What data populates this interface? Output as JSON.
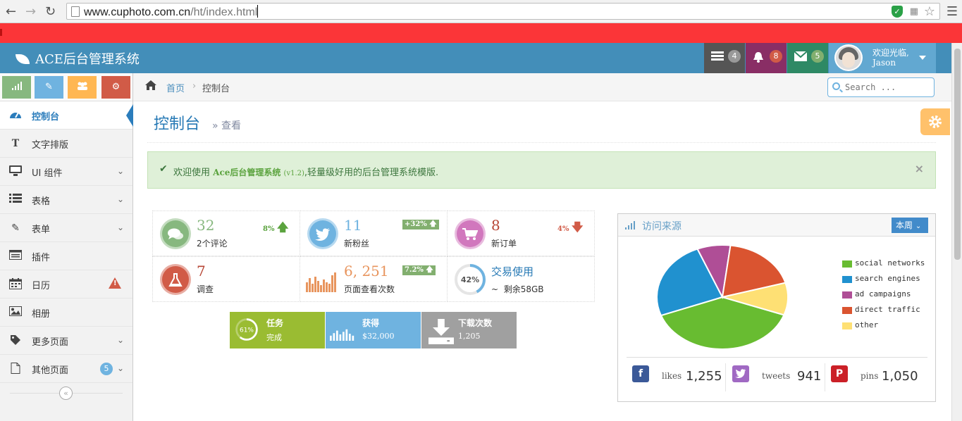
{
  "browser": {
    "url_host": "www.cuphoto.com.cn",
    "url_path": "/ht/index.html"
  },
  "navbar": {
    "brand": "ACE后台管理系统",
    "tasks_count": "4",
    "notifications_count": "8",
    "messages_count": "5",
    "user_greeting": "欢迎光临,",
    "user_name": "Jason"
  },
  "sidebar": {
    "items": [
      {
        "label": "控制台"
      },
      {
        "label": "文字排版"
      },
      {
        "label": "UI 组件"
      },
      {
        "label": "表格"
      },
      {
        "label": "表单"
      },
      {
        "label": "插件"
      },
      {
        "label": "日历"
      },
      {
        "label": "相册"
      },
      {
        "label": "更多页面"
      },
      {
        "label": "其他页面",
        "badge": "5"
      }
    ]
  },
  "breadcrumb": {
    "home": "首页",
    "current": "控制台"
  },
  "search": {
    "placeholder": "Search ..."
  },
  "page": {
    "title": "控制台",
    "subtitle": "查看"
  },
  "alert": {
    "prefix": "欢迎使用 ",
    "product": "Ace后台管理系统",
    "version": "(v1.2)",
    "suffix": ",轻量级好用的后台管理系统模版."
  },
  "infoboxes": [
    {
      "number": "32",
      "text": "2个评论",
      "stat": "8%"
    },
    {
      "number": "11",
      "text": "新粉丝",
      "stat": "+32%"
    },
    {
      "number": "8",
      "text": "新订单",
      "stat": "4%"
    },
    {
      "number": "7",
      "text": "调查"
    },
    {
      "number": "6, 251",
      "text": "页面查看次数",
      "stat": "7.2%"
    },
    {
      "number": "交易使用",
      "text": "剩余58GB",
      "percent": "42%",
      "percent_value": 42
    }
  ],
  "darkboxes": [
    {
      "title": "任务",
      "value": "完成",
      "percent": "61%",
      "percent_value": 61
    },
    {
      "title": "获得",
      "value": "$32,000"
    },
    {
      "title": "下载次数",
      "value": "1,205"
    }
  ],
  "widget": {
    "title": "访问来源",
    "dropdown": "本周",
    "legend": [
      {
        "label": "social networks",
        "value": 38.7,
        "color": "#68bc31"
      },
      {
        "label": "search engines",
        "value": 24.5,
        "color": "#2091cf"
      },
      {
        "label": "ad campaigns",
        "value": 8.2,
        "color": "#af4e96"
      },
      {
        "label": "direct traffic",
        "value": 18.6,
        "color": "#da5430"
      },
      {
        "label": "other",
        "value": 10,
        "color": "#fee074"
      }
    ],
    "stats": [
      {
        "label": "likes",
        "value": "1,255"
      },
      {
        "label": "tweets",
        "value": "941"
      },
      {
        "label": "pins",
        "value": "1,050"
      }
    ]
  },
  "colors": {
    "navbar": "#438eb9",
    "red_bar": "#fb3538",
    "accent_blue": "#2b7dbc"
  }
}
